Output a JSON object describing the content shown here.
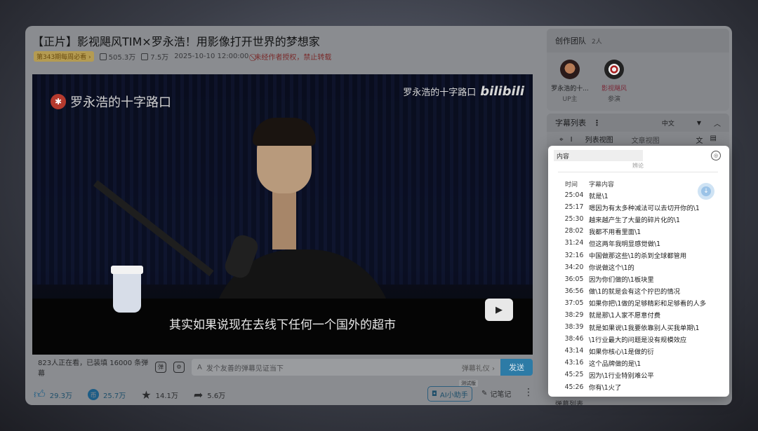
{
  "video": {
    "title": "【正片】影视飓风TIM×罗永浩！用影像打开世界的梦想家",
    "badge": "第343期每周必看 ›",
    "plays": "505.3万",
    "danmaku_count": "7.5万",
    "date": "2025-10-10 12:00:00",
    "copyright": "未经作者授权，禁止转载",
    "logo_left": "罗永浩的十字路口",
    "logo_right": "罗永浩的十字路口",
    "logo_right_brand": "bilibili",
    "subtitle": "其实如果说现在去线下任何一个国外的超市"
  },
  "danmu_bar": {
    "status": "823人正在看，已装填 16000 条弹幕",
    "placeholder": "发个友善的弹幕见证当下",
    "etiquette": "弹幕礼仪 ›",
    "send": "发送"
  },
  "actions": {
    "like": "29.3万",
    "coin": "25.7万",
    "favorite": "14.1万",
    "share": "5.6万",
    "ai_assistant": "AI小助手",
    "beta_tag": "测试版",
    "notes": "记笔记"
  },
  "team": {
    "title": "创作团队",
    "count": "2人",
    "members": [
      {
        "name": "罗永浩的十...",
        "role": "UP主"
      },
      {
        "name": "影视飓风",
        "role": "参演"
      }
    ]
  },
  "subtitles": {
    "title": "字幕列表",
    "language": "中文",
    "tab_list": "列表视图",
    "tab_article": "文章视图",
    "search_placeholder": "内容",
    "cut_text": "辨论",
    "col_time": "时间",
    "col_content": "字幕内容",
    "rows": [
      {
        "time": "25:04",
        "text": "就是\\1"
      },
      {
        "time": "25:17",
        "text": "嗯因为有太多种减法可以去切开你的\\1"
      },
      {
        "time": "25:30",
        "text": "越来越产生了大量的碎片化的\\1"
      },
      {
        "time": "28:02",
        "text": "我都不用看里面\\1"
      },
      {
        "time": "31:24",
        "text": "但这两年我明显感觉做\\1"
      },
      {
        "time": "32:16",
        "text": "中国做那这些\\1的杀到全球都管用"
      },
      {
        "time": "34:20",
        "text": "你说做这个\\1的"
      },
      {
        "time": "36:05",
        "text": "因为你们做的\\1板块里"
      },
      {
        "time": "36:56",
        "text": "做\\1的就是会有这个拧巴的情况"
      },
      {
        "time": "37:05",
        "text": "如果你把\\1做的足够精彩和足够看的人多"
      },
      {
        "time": "38:29",
        "text": "就是那\\1人家不愿意付费"
      },
      {
        "time": "38:39",
        "text": "就是如果说\\1我要依靠别人买我单期\\1"
      },
      {
        "time": "38:46",
        "text": "\\1行业最大的问题是没有规模效应"
      },
      {
        "time": "43:14",
        "text": "如果你核心\\1是做的衍"
      },
      {
        "time": "43:16",
        "text": "这个品牌做的是\\1"
      },
      {
        "time": "45:25",
        "text": "因为\\1行业特别难公平"
      },
      {
        "time": "45:26",
        "text": "你有\\1火了"
      }
    ]
  },
  "danmu_list": {
    "title": "弹幕列表"
  }
}
